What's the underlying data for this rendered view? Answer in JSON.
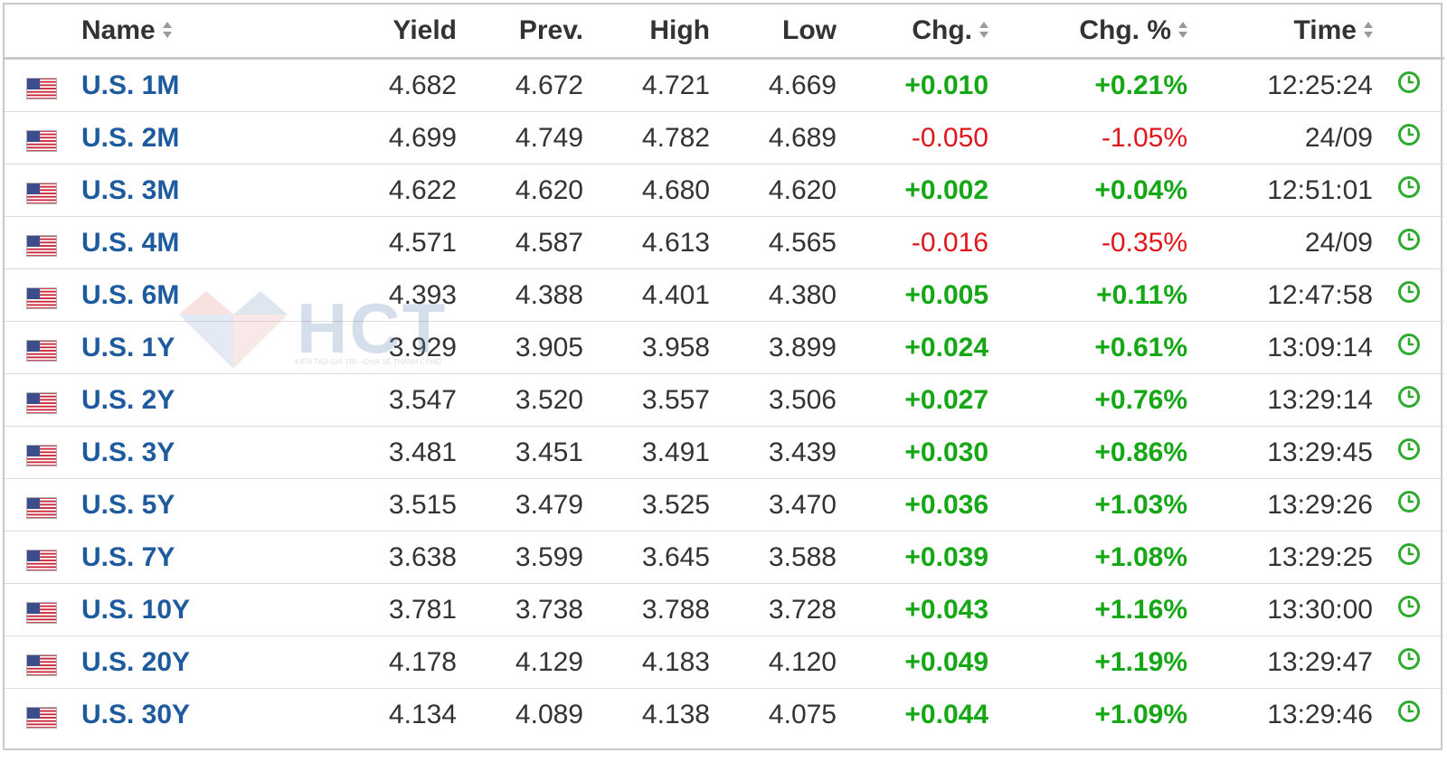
{
  "header": {
    "name": "Name",
    "yield": "Yield",
    "prev": "Prev.",
    "high": "High",
    "low": "Low",
    "chg": "Chg.",
    "chg_pct": "Chg. %",
    "time": "Time"
  },
  "colors": {
    "up": "#16a716",
    "down": "#e0161b",
    "link": "#1d5a9e"
  },
  "icons": {
    "flag": "us-flag-icon",
    "clock": "clock-icon",
    "sort": "sort-icon"
  },
  "rows": [
    {
      "name": "U.S. 1M",
      "yield": "4.682",
      "prev": "4.672",
      "high": "4.721",
      "low": "4.669",
      "chg": "+0.010",
      "chg_pct": "+0.21%",
      "time": "12:25:24",
      "dir": "up"
    },
    {
      "name": "U.S. 2M",
      "yield": "4.699",
      "prev": "4.749",
      "high": "4.782",
      "low": "4.689",
      "chg": "-0.050",
      "chg_pct": "-1.05%",
      "time": "24/09",
      "dir": "down"
    },
    {
      "name": "U.S. 3M",
      "yield": "4.622",
      "prev": "4.620",
      "high": "4.680",
      "low": "4.620",
      "chg": "+0.002",
      "chg_pct": "+0.04%",
      "time": "12:51:01",
      "dir": "up"
    },
    {
      "name": "U.S. 4M",
      "yield": "4.571",
      "prev": "4.587",
      "high": "4.613",
      "low": "4.565",
      "chg": "-0.016",
      "chg_pct": "-0.35%",
      "time": "24/09",
      "dir": "down"
    },
    {
      "name": "U.S. 6M",
      "yield": "4.393",
      "prev": "4.388",
      "high": "4.401",
      "low": "4.380",
      "chg": "+0.005",
      "chg_pct": "+0.11%",
      "time": "12:47:58",
      "dir": "up"
    },
    {
      "name": "U.S. 1Y",
      "yield": "3.929",
      "prev": "3.905",
      "high": "3.958",
      "low": "3.899",
      "chg": "+0.024",
      "chg_pct": "+0.61%",
      "time": "13:09:14",
      "dir": "up"
    },
    {
      "name": "U.S. 2Y",
      "yield": "3.547",
      "prev": "3.520",
      "high": "3.557",
      "low": "3.506",
      "chg": "+0.027",
      "chg_pct": "+0.76%",
      "time": "13:29:14",
      "dir": "up"
    },
    {
      "name": "U.S. 3Y",
      "yield": "3.481",
      "prev": "3.451",
      "high": "3.491",
      "low": "3.439",
      "chg": "+0.030",
      "chg_pct": "+0.86%",
      "time": "13:29:45",
      "dir": "up"
    },
    {
      "name": "U.S. 5Y",
      "yield": "3.515",
      "prev": "3.479",
      "high": "3.525",
      "low": "3.470",
      "chg": "+0.036",
      "chg_pct": "+1.03%",
      "time": "13:29:26",
      "dir": "up"
    },
    {
      "name": "U.S. 7Y",
      "yield": "3.638",
      "prev": "3.599",
      "high": "3.645",
      "low": "3.588",
      "chg": "+0.039",
      "chg_pct": "+1.08%",
      "time": "13:29:25",
      "dir": "up"
    },
    {
      "name": "U.S. 10Y",
      "yield": "3.781",
      "prev": "3.738",
      "high": "3.788",
      "low": "3.728",
      "chg": "+0.043",
      "chg_pct": "+1.16%",
      "time": "13:30:00",
      "dir": "up"
    },
    {
      "name": "U.S. 20Y",
      "yield": "4.178",
      "prev": "4.129",
      "high": "4.183",
      "low": "4.120",
      "chg": "+0.049",
      "chg_pct": "+1.19%",
      "time": "13:29:47",
      "dir": "up"
    },
    {
      "name": "U.S. 30Y",
      "yield": "4.134",
      "prev": "4.089",
      "high": "4.138",
      "low": "4.075",
      "chg": "+0.044",
      "chg_pct": "+1.09%",
      "time": "13:29:46",
      "dir": "up"
    }
  ],
  "watermark": {
    "text": "HCT",
    "tagline": "KIẾN TẠO GIÁ TRỊ - CHIA SẺ THÀNH CÔNG"
  }
}
